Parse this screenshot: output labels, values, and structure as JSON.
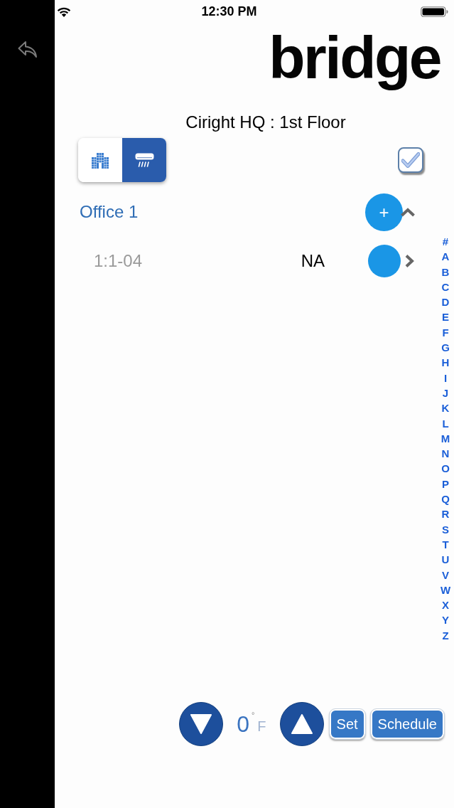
{
  "status_bar": {
    "time": "12:30 PM"
  },
  "logo": {
    "text": "bridge"
  },
  "title": "Ciright HQ : 1st Floor",
  "view_toggle": [
    {
      "kind": "building",
      "selected": false
    },
    {
      "kind": "ac",
      "selected": true
    }
  ],
  "select_all": {
    "checked": true
  },
  "group": {
    "name": "Office 1",
    "expanded": true,
    "add_label": "+",
    "children": [
      {
        "name": "1:1-04",
        "reading": "NA"
      }
    ]
  },
  "index": [
    "#",
    "A",
    "B",
    "C",
    "D",
    "E",
    "F",
    "G",
    "H",
    "I",
    "J",
    "K",
    "L",
    "M",
    "N",
    "O",
    "P",
    "Q",
    "R",
    "S",
    "T",
    "U",
    "V",
    "W",
    "X",
    "Y",
    "Z"
  ],
  "thermostat": {
    "value": "0",
    "degree": "°",
    "unit": "F"
  },
  "buttons": [
    {
      "label": "Set"
    },
    {
      "label": "Schedule"
    }
  ]
}
